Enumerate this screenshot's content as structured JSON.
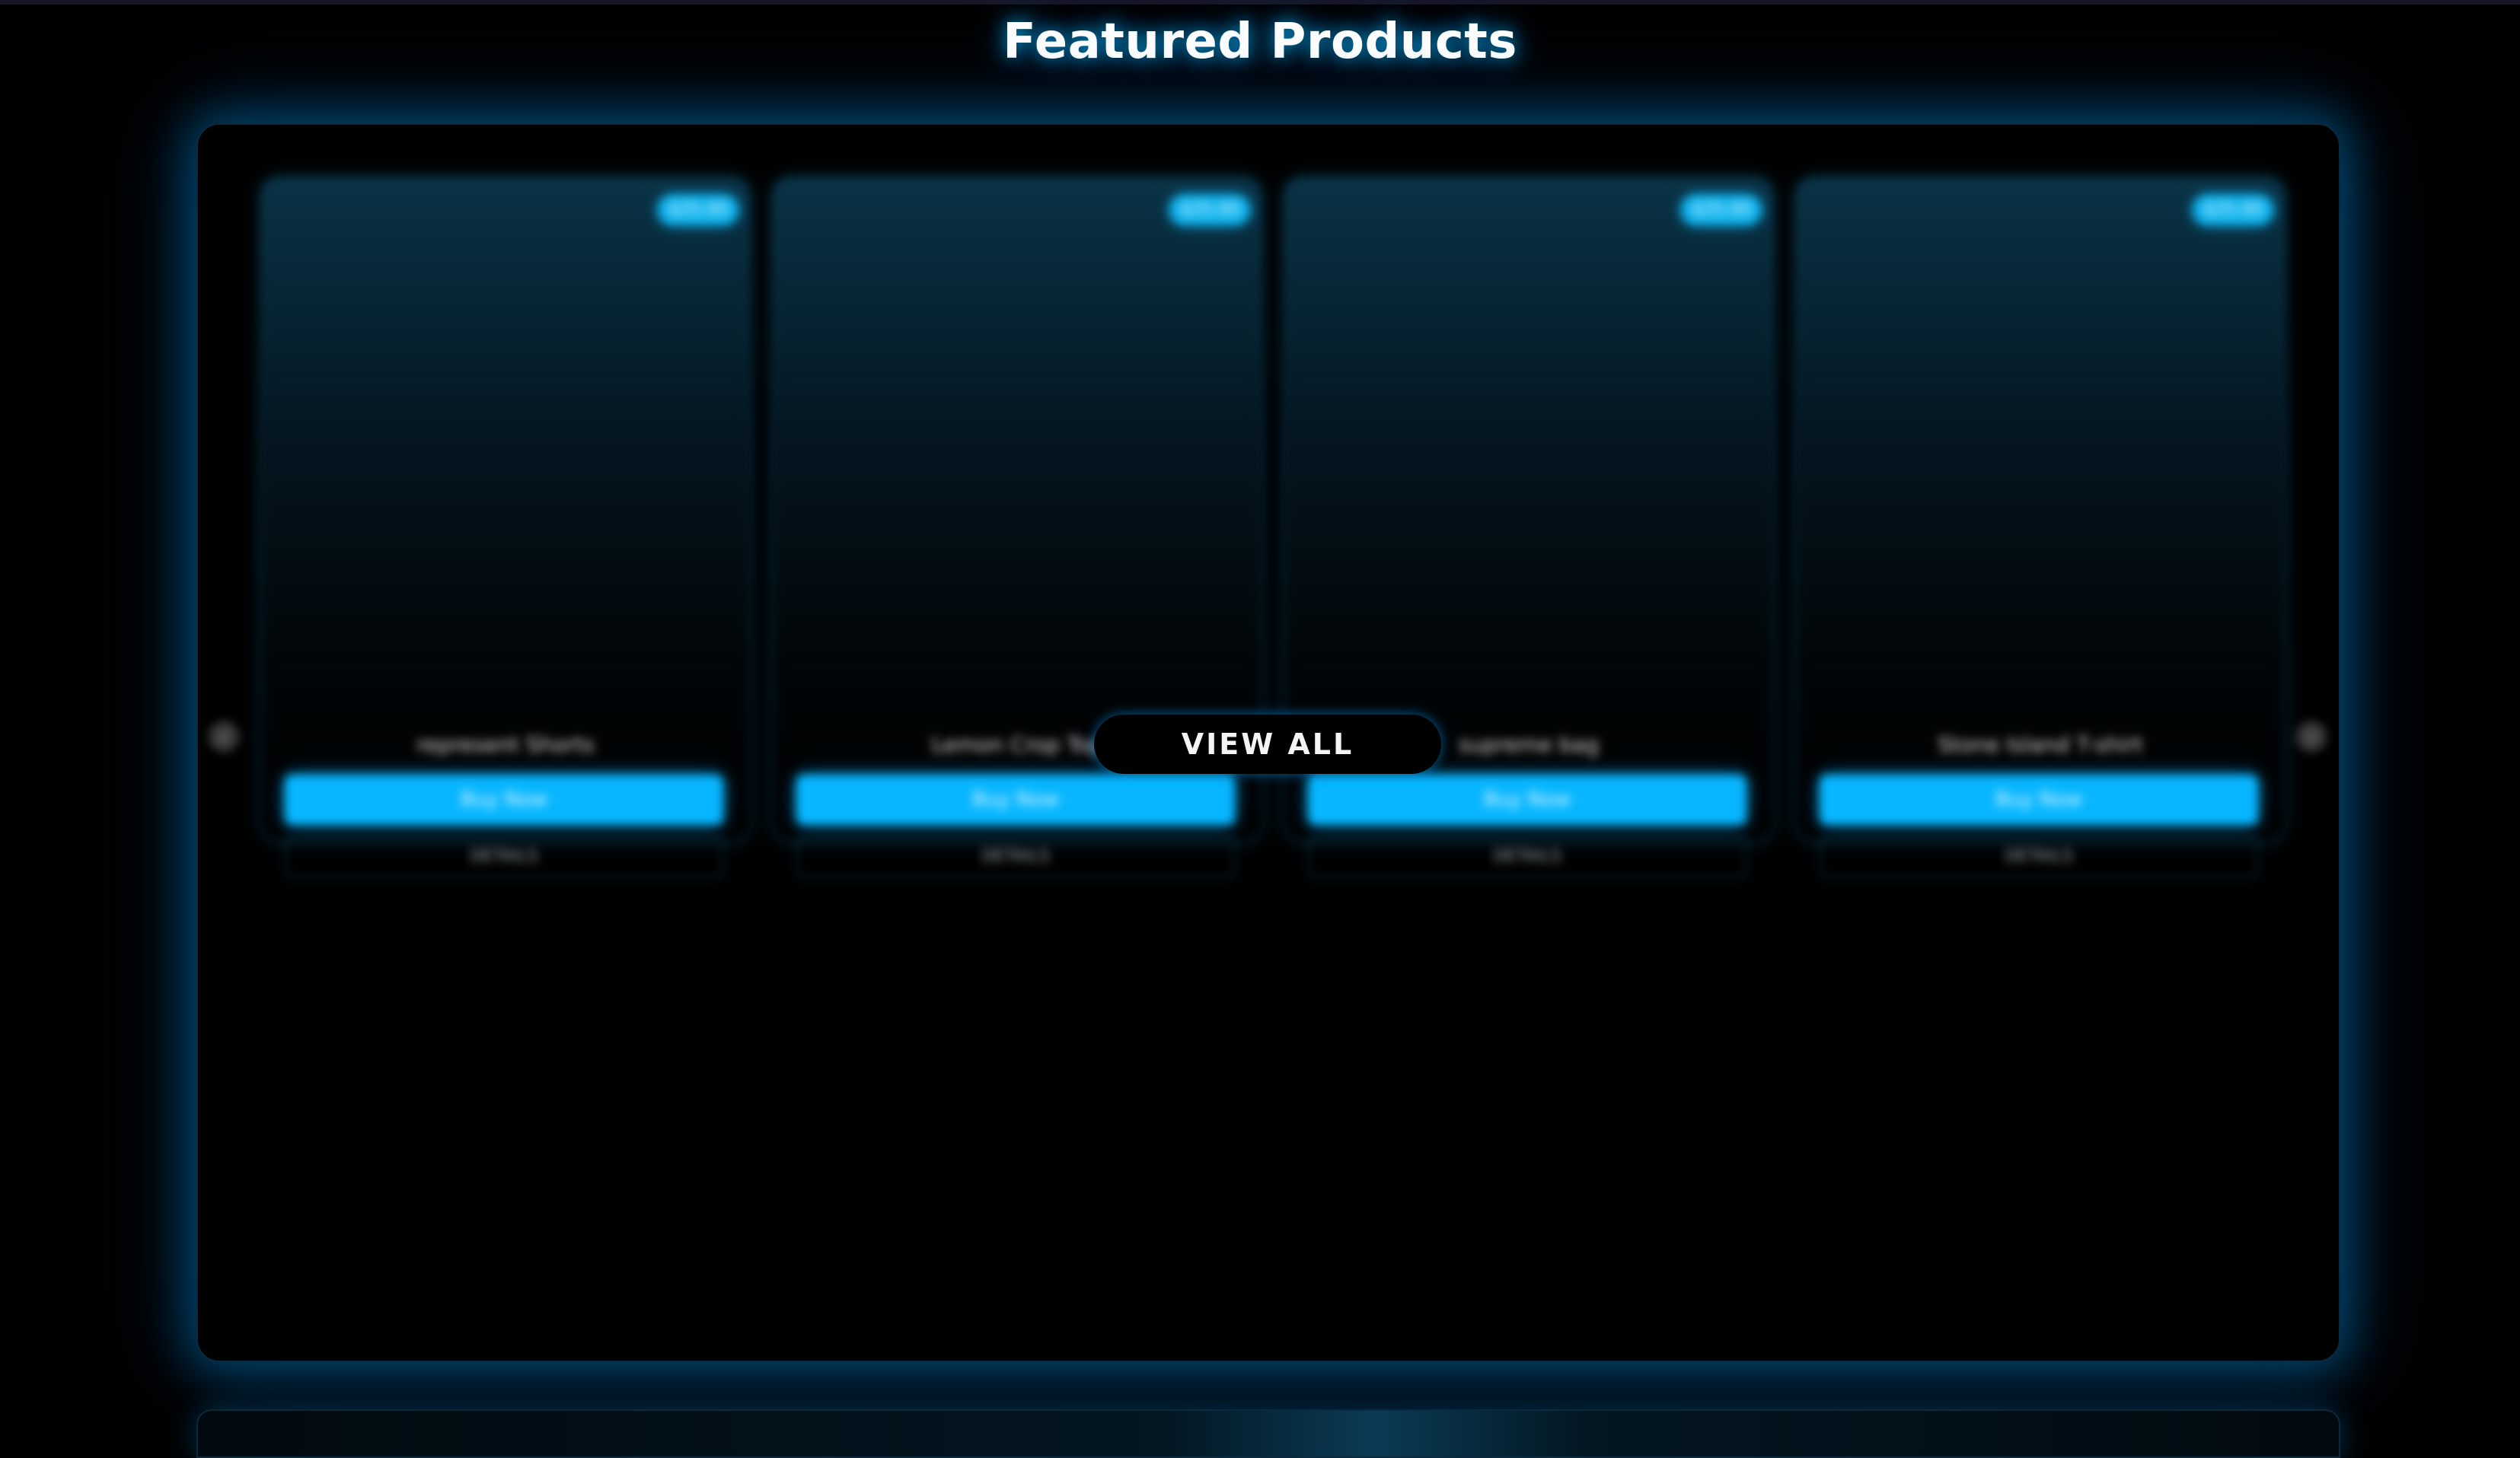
{
  "header": {
    "title": "Featured Products"
  },
  "carousel": {
    "prev_icon": "chevron-left-icon",
    "next_icon": "chevron-right-icon",
    "prev_glyph": "‹",
    "next_glyph": "›",
    "view_all_label": "VIEW ALL",
    "products": [
      {
        "name": "represent Shorts",
        "price": "$25.00",
        "buy_label": "Buy Now",
        "details_label": "DETAILS"
      },
      {
        "name": "Lemon Crop Top",
        "price": "$25.00",
        "buy_label": "Buy Now",
        "details_label": "DETAILS"
      },
      {
        "name": "supreme bag",
        "price": "$25.00",
        "buy_label": "Buy Now",
        "details_label": "DETAILS"
      },
      {
        "name": "Stone Island T-shirt",
        "price": "$25.00",
        "buy_label": "Buy Now",
        "details_label": "DETAILS"
      }
    ]
  },
  "colors": {
    "accent": "#07b6ff",
    "background": "#000000",
    "glow": "#008cdc"
  }
}
